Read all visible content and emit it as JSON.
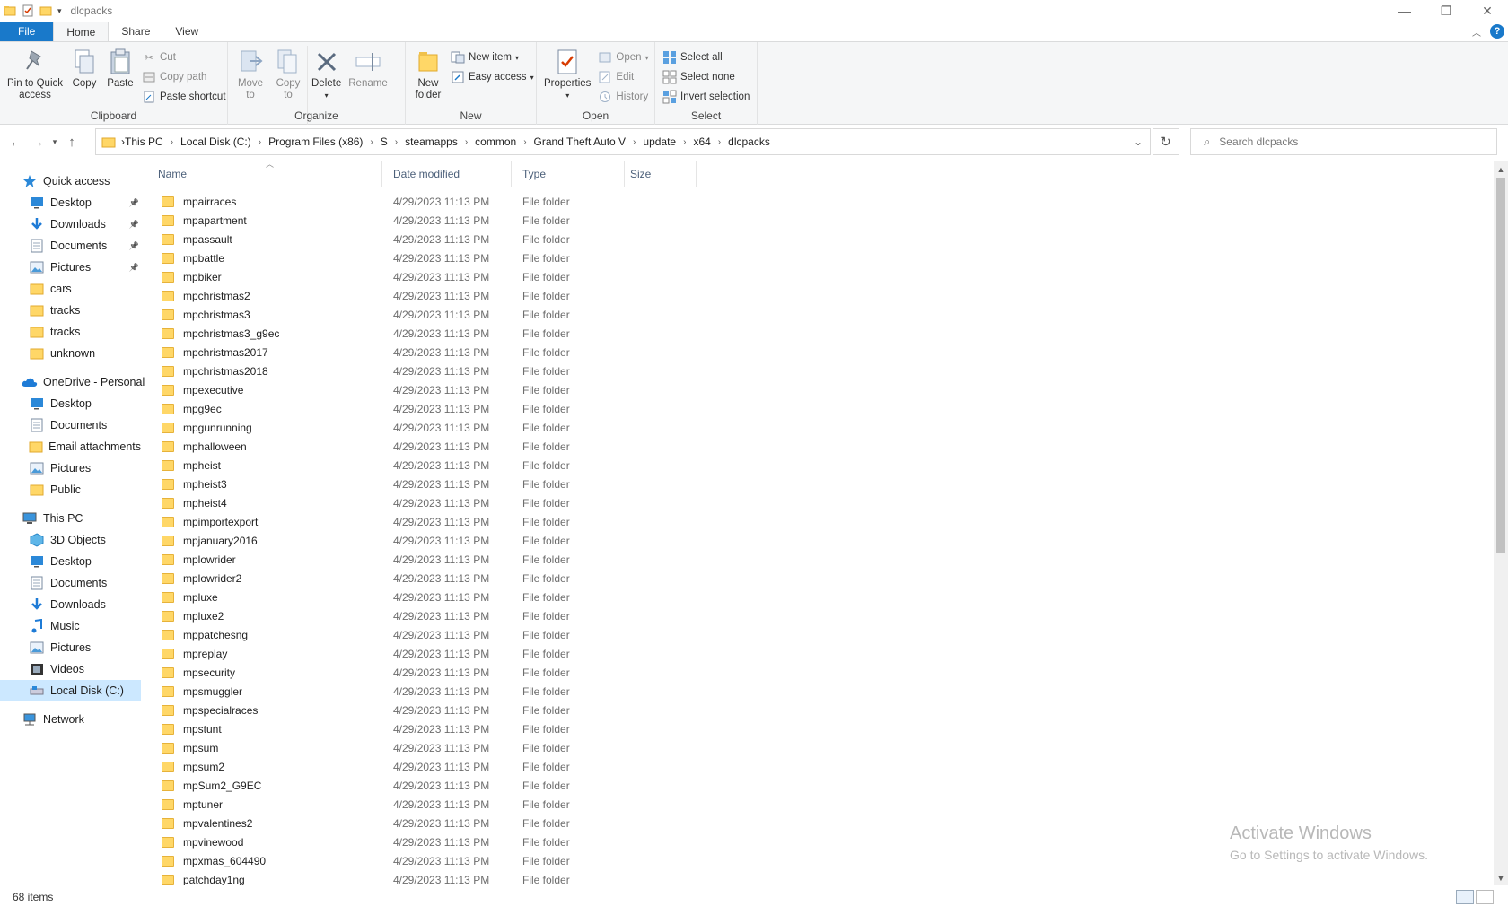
{
  "window": {
    "title": "dlcpacks",
    "icons": [
      "folder-icon",
      "properties-icon",
      "new-folder-icon",
      "qat-dropdown-icon"
    ]
  },
  "caption": {
    "minimize": "—",
    "restore": "❐",
    "close": "✕"
  },
  "tabs": [
    {
      "label": "File"
    },
    {
      "label": "Home"
    },
    {
      "label": "Share"
    },
    {
      "label": "View"
    }
  ],
  "ribbon": {
    "clipboard": {
      "label": "Clipboard",
      "pin": "Pin to Quick access",
      "copy": "Copy",
      "paste": "Paste",
      "cut": "Cut",
      "copy_path": "Copy path",
      "paste_shortcut": "Paste shortcut"
    },
    "organize": {
      "label": "Organize",
      "move_to": "Move to",
      "copy_to": "Copy to",
      "delete": "Delete",
      "rename": "Rename"
    },
    "new": {
      "label": "New",
      "new_folder": "New folder",
      "new_item": "New item",
      "easy_access": "Easy access"
    },
    "open": {
      "label": "Open",
      "properties": "Properties",
      "open": "Open",
      "edit": "Edit",
      "history": "History"
    },
    "select": {
      "label": "Select",
      "select_all": "Select all",
      "select_none": "Select none",
      "invert": "Invert selection"
    }
  },
  "address": {
    "crumbs": [
      "This PC",
      "Local Disk (C:)",
      "Program Files (x86)",
      "S",
      "steamapps",
      "common",
      "Grand Theft Auto V",
      "update",
      "x64",
      "dlcpacks"
    ]
  },
  "search": {
    "placeholder": "Search dlcpacks"
  },
  "navpane": {
    "quick_access": "Quick access",
    "quick_items": [
      {
        "label": "Desktop",
        "icon": "desktop-icon",
        "pinned": true
      },
      {
        "label": "Downloads",
        "icon": "downloads-icon",
        "pinned": true
      },
      {
        "label": "Documents",
        "icon": "documents-icon",
        "pinned": true
      },
      {
        "label": "Pictures",
        "icon": "pictures-icon",
        "pinned": true
      },
      {
        "label": "cars",
        "icon": "folder-icon",
        "pinned": false
      },
      {
        "label": "tracks",
        "icon": "folder-icon",
        "pinned": false
      },
      {
        "label": "tracks",
        "icon": "folder-icon",
        "pinned": false
      },
      {
        "label": "unknown",
        "icon": "folder-icon",
        "pinned": false
      }
    ],
    "onedrive": "OneDrive - Personal",
    "onedrive_items": [
      {
        "label": "Desktop",
        "icon": "desktop-icon"
      },
      {
        "label": "Documents",
        "icon": "documents-icon"
      },
      {
        "label": "Email attachments",
        "icon": "folder-icon"
      },
      {
        "label": "Pictures",
        "icon": "pictures-icon"
      },
      {
        "label": "Public",
        "icon": "folder-icon"
      }
    ],
    "thispc": "This PC",
    "thispc_items": [
      {
        "label": "3D Objects",
        "icon": "3d-objects-icon"
      },
      {
        "label": "Desktop",
        "icon": "desktop-icon"
      },
      {
        "label": "Documents",
        "icon": "documents-icon"
      },
      {
        "label": "Downloads",
        "icon": "downloads-icon"
      },
      {
        "label": "Music",
        "icon": "music-icon"
      },
      {
        "label": "Pictures",
        "icon": "pictures-icon"
      },
      {
        "label": "Videos",
        "icon": "videos-icon"
      },
      {
        "label": "Local Disk (C:)",
        "icon": "local-disk-icon",
        "selected": true
      }
    ],
    "network": "Network"
  },
  "columns": {
    "name": "Name",
    "date": "Date modified",
    "type": "Type",
    "size": "Size"
  },
  "files": [
    {
      "name": "mpairraces",
      "date": "4/29/2023 11:13 PM",
      "type": "File folder"
    },
    {
      "name": "mpapartment",
      "date": "4/29/2023 11:13 PM",
      "type": "File folder"
    },
    {
      "name": "mpassault",
      "date": "4/29/2023 11:13 PM",
      "type": "File folder"
    },
    {
      "name": "mpbattle",
      "date": "4/29/2023 11:13 PM",
      "type": "File folder"
    },
    {
      "name": "mpbiker",
      "date": "4/29/2023 11:13 PM",
      "type": "File folder"
    },
    {
      "name": "mpchristmas2",
      "date": "4/29/2023 11:13 PM",
      "type": "File folder"
    },
    {
      "name": "mpchristmas3",
      "date": "4/29/2023 11:13 PM",
      "type": "File folder"
    },
    {
      "name": "mpchristmas3_g9ec",
      "date": "4/29/2023 11:13 PM",
      "type": "File folder"
    },
    {
      "name": "mpchristmas2017",
      "date": "4/29/2023 11:13 PM",
      "type": "File folder"
    },
    {
      "name": "mpchristmas2018",
      "date": "4/29/2023 11:13 PM",
      "type": "File folder"
    },
    {
      "name": "mpexecutive",
      "date": "4/29/2023 11:13 PM",
      "type": "File folder"
    },
    {
      "name": "mpg9ec",
      "date": "4/29/2023 11:13 PM",
      "type": "File folder"
    },
    {
      "name": "mpgunrunning",
      "date": "4/29/2023 11:13 PM",
      "type": "File folder"
    },
    {
      "name": "mphalloween",
      "date": "4/29/2023 11:13 PM",
      "type": "File folder"
    },
    {
      "name": "mpheist",
      "date": "4/29/2023 11:13 PM",
      "type": "File folder"
    },
    {
      "name": "mpheist3",
      "date": "4/29/2023 11:13 PM",
      "type": "File folder"
    },
    {
      "name": "mpheist4",
      "date": "4/29/2023 11:13 PM",
      "type": "File folder"
    },
    {
      "name": "mpimportexport",
      "date": "4/29/2023 11:13 PM",
      "type": "File folder"
    },
    {
      "name": "mpjanuary2016",
      "date": "4/29/2023 11:13 PM",
      "type": "File folder"
    },
    {
      "name": "mplowrider",
      "date": "4/29/2023 11:13 PM",
      "type": "File folder"
    },
    {
      "name": "mplowrider2",
      "date": "4/29/2023 11:13 PM",
      "type": "File folder"
    },
    {
      "name": "mpluxe",
      "date": "4/29/2023 11:13 PM",
      "type": "File folder"
    },
    {
      "name": "mpluxe2",
      "date": "4/29/2023 11:13 PM",
      "type": "File folder"
    },
    {
      "name": "mppatchesng",
      "date": "4/29/2023 11:13 PM",
      "type": "File folder"
    },
    {
      "name": "mpreplay",
      "date": "4/29/2023 11:13 PM",
      "type": "File folder"
    },
    {
      "name": "mpsecurity",
      "date": "4/29/2023 11:13 PM",
      "type": "File folder"
    },
    {
      "name": "mpsmuggler",
      "date": "4/29/2023 11:13 PM",
      "type": "File folder"
    },
    {
      "name": "mpspecialraces",
      "date": "4/29/2023 11:13 PM",
      "type": "File folder"
    },
    {
      "name": "mpstunt",
      "date": "4/29/2023 11:13 PM",
      "type": "File folder"
    },
    {
      "name": "mpsum",
      "date": "4/29/2023 11:13 PM",
      "type": "File folder"
    },
    {
      "name": "mpsum2",
      "date": "4/29/2023 11:13 PM",
      "type": "File folder"
    },
    {
      "name": "mpSum2_G9EC",
      "date": "4/29/2023 11:13 PM",
      "type": "File folder"
    },
    {
      "name": "mptuner",
      "date": "4/29/2023 11:13 PM",
      "type": "File folder"
    },
    {
      "name": "mpvalentines2",
      "date": "4/29/2023 11:13 PM",
      "type": "File folder"
    },
    {
      "name": "mpvinewood",
      "date": "4/29/2023 11:13 PM",
      "type": "File folder"
    },
    {
      "name": "mpxmas_604490",
      "date": "4/29/2023 11:13 PM",
      "type": "File folder"
    },
    {
      "name": "patchday1ng",
      "date": "4/29/2023 11:13 PM",
      "type": "File folder"
    }
  ],
  "status": {
    "count": "68 items"
  },
  "watermark": {
    "line1": "Activate Windows",
    "line2": "Go to Settings to activate Windows."
  },
  "colors": {
    "accent": "#1979ca",
    "folder": "#ffd767",
    "selection": "#cce8ff"
  }
}
